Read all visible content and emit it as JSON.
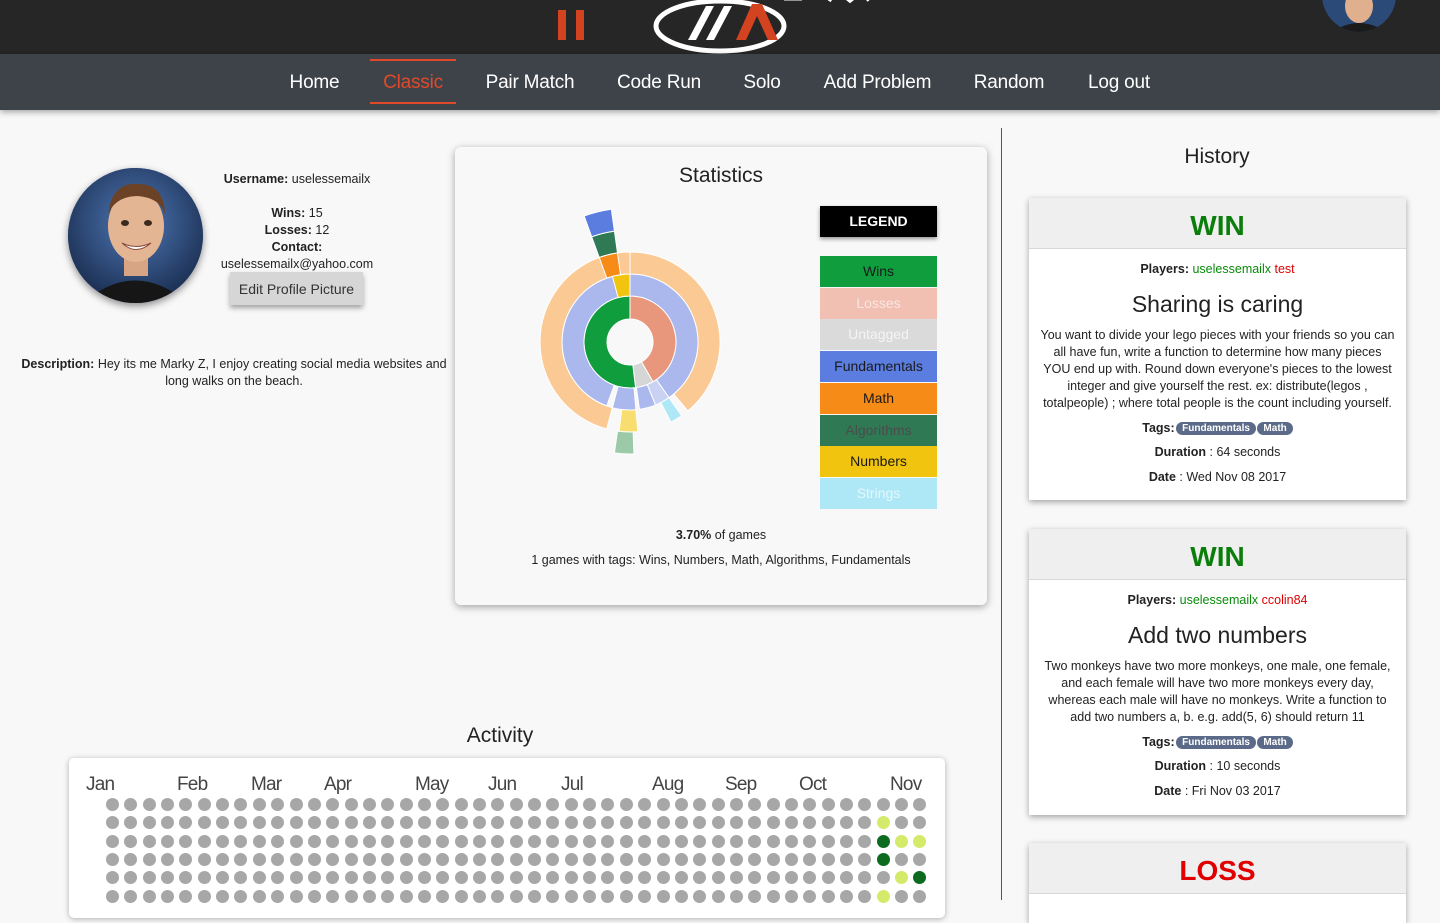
{
  "nav": {
    "items": [
      "Home",
      "Classic",
      "Pair Match",
      "Code Run",
      "Solo",
      "Add Problem",
      "Random",
      "Log out"
    ],
    "active": "Classic"
  },
  "profile": {
    "username_label": "Username:",
    "username": "uselessemailx",
    "wins_label": "Wins:",
    "wins": "15",
    "losses_label": "Losses:",
    "losses": "12",
    "contact_label": "Contact:",
    "contact": "uselessemailx@yahoo.com",
    "edit_button": "Edit Profile Picture",
    "description_label": "Description:",
    "description": "Hey its me Marky Z, I enjoy creating social media websites and long walks on the beach."
  },
  "statistics": {
    "title": "Statistics",
    "legend_title": "LEGEND",
    "legend": [
      {
        "label": "Wins",
        "bg": "#0f9d3e",
        "fg": "#1a1a1a"
      },
      {
        "label": "Losses",
        "bg": "#f2bfb3",
        "fg": "#f8e6e0"
      },
      {
        "label": "Untagged",
        "bg": "#dadada",
        "fg": "#f5f5f5"
      },
      {
        "label": "Fundamentals",
        "bg": "#5b7de0",
        "fg": "#1a1a1a"
      },
      {
        "label": "Math",
        "bg": "#f68b17",
        "fg": "#1a1a1a"
      },
      {
        "label": "Algorithms",
        "bg": "#2f7a55",
        "fg": "#4b4b4b"
      },
      {
        "label": "Numbers",
        "bg": "#f1c40f",
        "fg": "#1a1a1a"
      },
      {
        "label": "Strings",
        "bg": "#aee8f6",
        "fg": "#e3f7fc"
      }
    ],
    "pct_value": "3.70%",
    "pct_suffix": "of games",
    "games_text": "1 games with tags: Wins, Numbers, Math, Algorithms, Fundamentals"
  },
  "activity": {
    "title": "Activity",
    "months": [
      "Jan",
      "Feb",
      "Mar",
      "Apr",
      "May",
      "Jun",
      "Jul",
      "Aug",
      "Sep",
      "Oct",
      "Nov"
    ],
    "colors": {
      "none": "#a7a7a7",
      "low": "#d4ea6a",
      "high": "#0c6b1e"
    }
  },
  "history": {
    "title": "History",
    "players_label": "Players:",
    "tags_label": "Tags:",
    "duration_label": "Duration",
    "date_label": "Date",
    "items": [
      {
        "result": "WIN",
        "player1": "uselessemailx",
        "player2": "test",
        "problem": "Sharing is caring",
        "description": "You want to divide your lego pieces with your friends so you can all have fun, write a function to determine how many pieces YOU end up with. Round down everyone's pieces to the lowest integer and give yourself the rest. ex: distribute(legos , totalpeople) ; where total people is the count including yourself.",
        "tags": [
          "Fundamentals",
          "Math"
        ],
        "duration": "64 seconds",
        "date": "Wed Nov 08 2017"
      },
      {
        "result": "WIN",
        "player1": "uselessemailx",
        "player2": "ccolin84",
        "problem": "Add two numbers",
        "description": "Two monkeys have two more monkeys, one male, one female, and each female will have two more monkeys every day, whereas each male will have no monkeys. Write a function to add two numbers a, b. e.g. add(5, 6) should return 11",
        "tags": [
          "Fundamentals",
          "Math"
        ],
        "duration": "10 seconds",
        "date": "Fri Nov 03 2017"
      },
      {
        "result": "LOSS"
      }
    ]
  }
}
